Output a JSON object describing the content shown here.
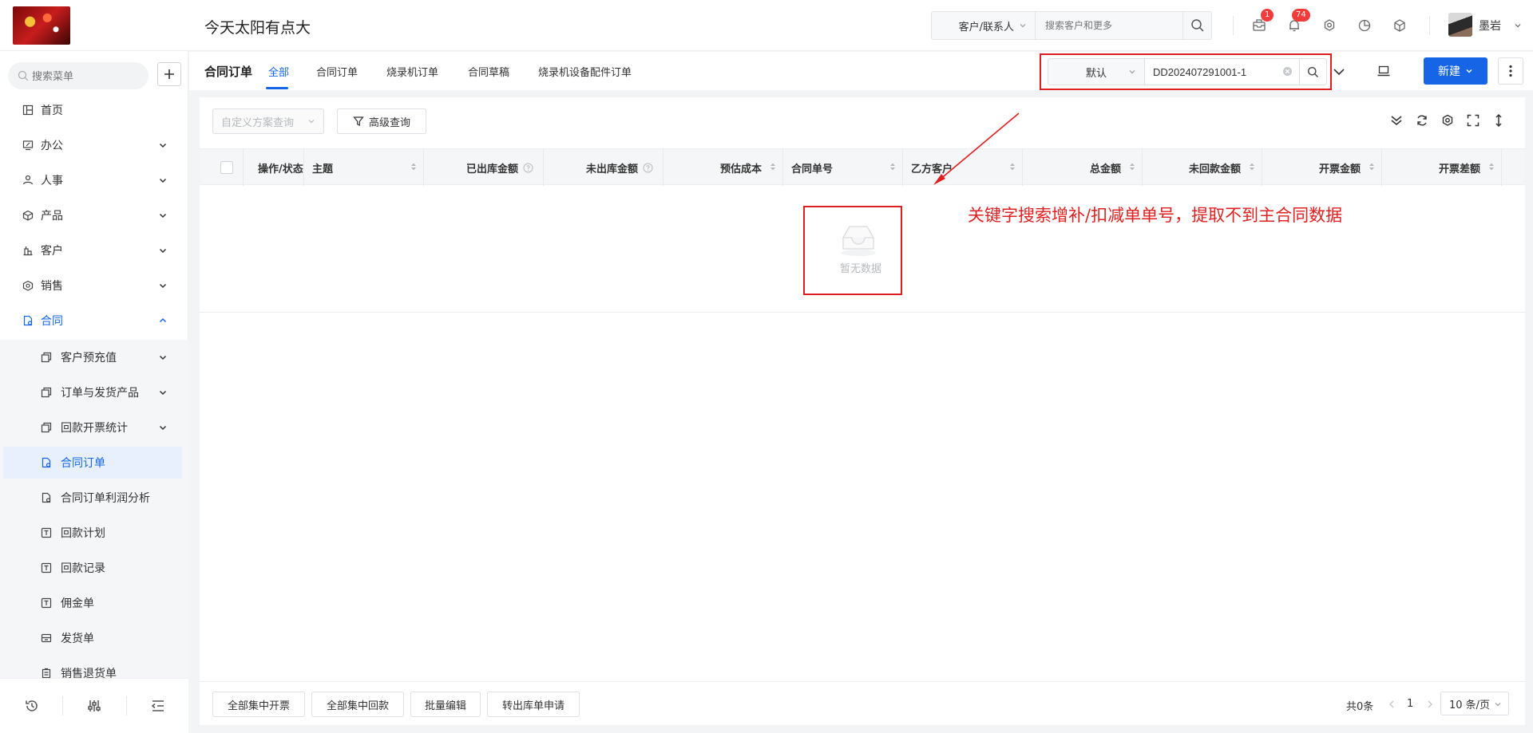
{
  "header": {
    "company_name": "今天太阳有点大",
    "search_type": "客户/联系人",
    "search_placeholder": "搜索客户和更多",
    "mail_badge": "1",
    "bell_badge": "74",
    "username": "墨岩"
  },
  "sidebar": {
    "search_placeholder": "搜索菜单",
    "items": [
      {
        "label": "首页",
        "icon": "home-icon"
      },
      {
        "label": "办公",
        "icon": "office-icon"
      },
      {
        "label": "人事",
        "icon": "people-icon"
      },
      {
        "label": "产品",
        "icon": "product-icon"
      },
      {
        "label": "客户",
        "icon": "customer-icon"
      },
      {
        "label": "销售",
        "icon": "sales-icon"
      },
      {
        "label": "合同",
        "icon": "contract-icon"
      }
    ],
    "sub_items": [
      {
        "label": "客户预充值",
        "icon": "copy-icon"
      },
      {
        "label": "订单与发货产品",
        "icon": "copy-icon"
      },
      {
        "label": "回款开票统计",
        "icon": "copy-icon"
      },
      {
        "label": "合同订单",
        "icon": "document-icon"
      },
      {
        "label": "合同订单利润分析",
        "icon": "document-icon"
      },
      {
        "label": "回款计划",
        "icon": "receipt-icon"
      },
      {
        "label": "回款记录",
        "icon": "receipt-icon"
      },
      {
        "label": "佣金单",
        "icon": "receipt-icon"
      },
      {
        "label": "发货单",
        "icon": "shipment-icon"
      },
      {
        "label": "销售退货单",
        "icon": "return-icon"
      }
    ]
  },
  "subheader": {
    "title": "合同订单",
    "tabs": [
      "全部",
      "合同订单",
      "烧录机订单",
      "合同草稿",
      "烧录机设备配件订单"
    ],
    "filter_select": "默认",
    "filter_value": "DD202407291001-1",
    "new_button": "新建"
  },
  "toolbar": {
    "scheme_placeholder": "自定义方案查询",
    "advanced_query": "高级查询"
  },
  "table": {
    "columns": [
      "操作/状态",
      "主题",
      "已出库金额",
      "未出库金额",
      "预估成本",
      "合同单号",
      "乙方客户",
      "总金额",
      "未回款金额",
      "开票金额",
      "开票差额"
    ],
    "empty_text": "暂无数据"
  },
  "annotation": {
    "text": "关键字搜索增补/扣减单单号，提取不到主合同数据",
    "color": "#e02020"
  },
  "footer": {
    "buttons": [
      "全部集中开票",
      "全部集中回款",
      "批量编辑",
      "转出库单申请"
    ],
    "total": "共0条",
    "page": "1",
    "page_size": "10 条/页"
  },
  "colors": {
    "accent": "#1565e6",
    "annotation": "#e02020",
    "badge": "#f23c3c"
  }
}
